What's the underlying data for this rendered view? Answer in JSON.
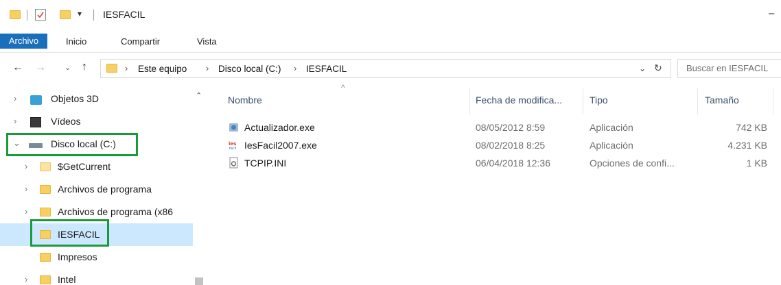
{
  "window": {
    "title": "IESFACIL",
    "minimize_glyph": "–"
  },
  "ribbon": {
    "tabs": [
      "Archivo",
      "Inicio",
      "Compartir",
      "Vista"
    ]
  },
  "address": {
    "breadcrumbs": [
      "Este equipo",
      "Disco local (C:)",
      "IESFACIL"
    ],
    "search_placeholder": "Buscar en IESFACIL"
  },
  "sidebar": {
    "items": [
      {
        "label": "Objetos 3D",
        "icon": "objects-3d-icon"
      },
      {
        "label": "Vídeos",
        "icon": "videos-icon"
      },
      {
        "label": "Disco local (C:)",
        "icon": "drive-icon"
      },
      {
        "label": "$GetCurrent",
        "icon": "folder-icon"
      },
      {
        "label": "Archivos de programa",
        "icon": "folder-icon"
      },
      {
        "label": "Archivos de programa (x86",
        "icon": "folder-icon"
      },
      {
        "label": "IESFACIL",
        "icon": "folder-icon"
      },
      {
        "label": "Impresos",
        "icon": "folder-icon"
      },
      {
        "label": "Intel",
        "icon": "folder-icon"
      }
    ]
  },
  "list": {
    "columns": [
      "Nombre",
      "Fecha de modifica...",
      "Tipo",
      "Tamaño"
    ],
    "files": [
      {
        "name": "Actualizador.exe",
        "date": "08/05/2012 8:59",
        "type": "Aplicación",
        "size": "742 KB"
      },
      {
        "name": "IesFacil2007.exe",
        "date": "08/02/2018 8:25",
        "type": "Aplicación",
        "size": "4.231 KB"
      },
      {
        "name": "TCPIP.INI",
        "date": "06/04/2018 12:36",
        "type": "Opciones de confi...",
        "size": "1 KB"
      }
    ]
  },
  "colors": {
    "accent": "#1a6fbd",
    "selection": "#cce8ff",
    "highlight_box": "#1a9a3a",
    "folder": "#f8cf63"
  }
}
